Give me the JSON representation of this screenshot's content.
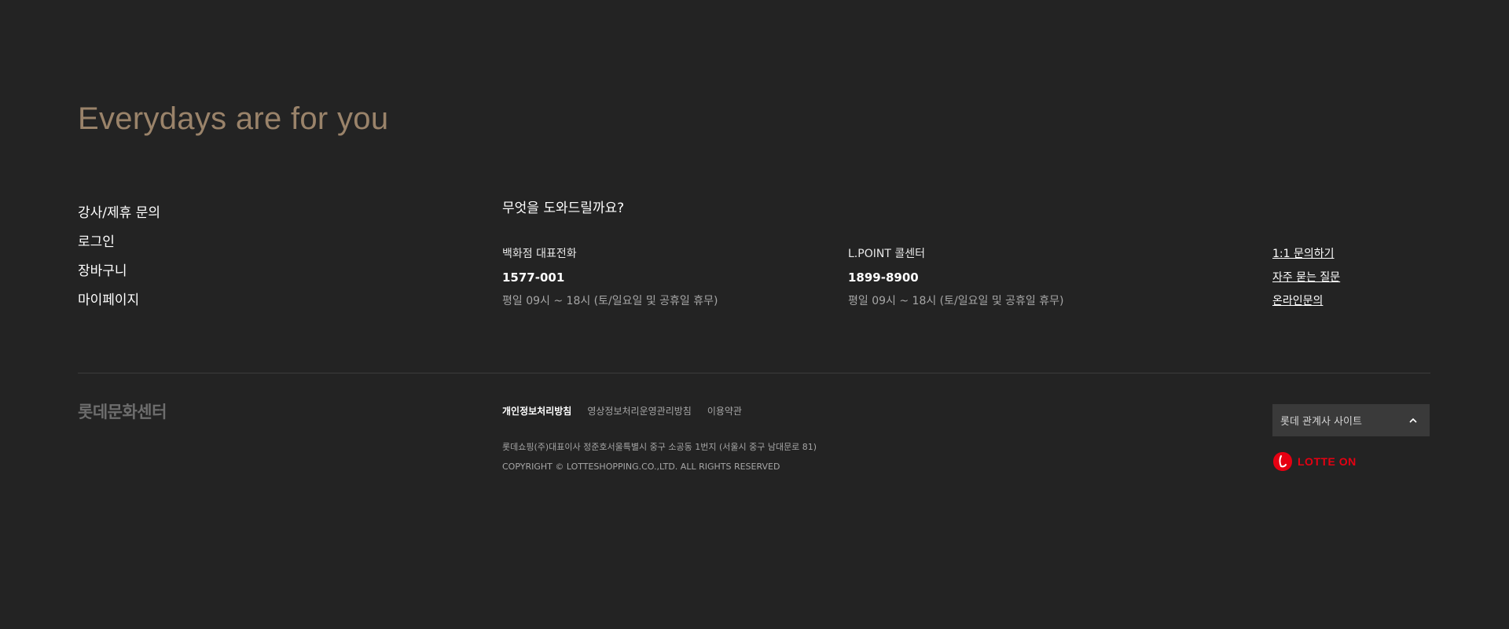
{
  "tagline": "Everydays are for you",
  "quick_links": [
    {
      "label": "강사/제휴 문의"
    },
    {
      "label": "로그인"
    },
    {
      "label": "장바구니"
    },
    {
      "label": "마이페이지"
    }
  ],
  "help": {
    "title": "무엇을 도와드릴까요?",
    "contacts": [
      {
        "label": "백화점 대표전화",
        "phone": "1577-001",
        "hours": "평일 09시 ~ 18시 (토/일요일 및 공휴일 휴무)"
      },
      {
        "label": "L.POINT 콜센터",
        "phone": "1899-8900",
        "hours": "평일 09시 ~ 18시 (토/일요일 및 공휴일 휴무)"
      }
    ],
    "inquiry_links": [
      {
        "label": "1:1 문의하기"
      },
      {
        "label": "자주 묻는 질문"
      },
      {
        "label": "온라인문의"
      }
    ]
  },
  "footer": {
    "brand": "롯데문화센터",
    "policies": [
      {
        "label": "개인정보처리방침"
      },
      {
        "label": "영상정보처리운영관리방침"
      },
      {
        "label": "이용약관"
      }
    ],
    "address": "롯데쇼핑(주)대표이사 정준호서울특별시 중구 소공동 1번지 (서울시 중구 남대문로 81)",
    "copyright": "COPYRIGHT © LOTTESHOPPING.CO.,LTD. ALL RIGHTS RESERVED",
    "family_site": {
      "label": "롯데 관계사 사이트",
      "icon": "chevron-up-icon"
    },
    "lotteon": {
      "wordmark": "LOTTE ON",
      "icon": "lotteon-logo-icon"
    }
  },
  "colors": {
    "background": "#232323",
    "tagline": "#9a836a",
    "brand_red": "#e60012",
    "muted_text": "#a6a6a6"
  }
}
